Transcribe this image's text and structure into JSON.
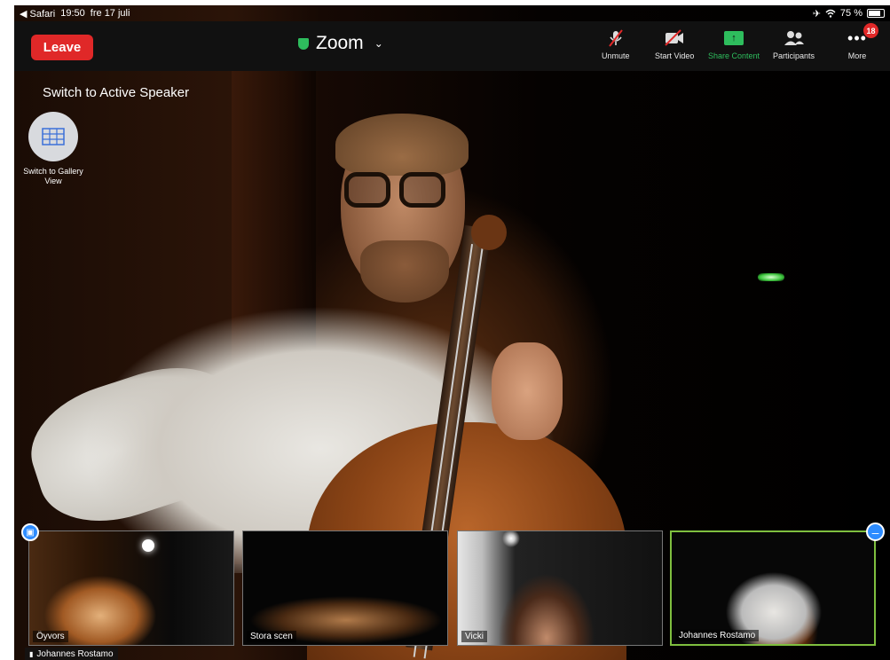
{
  "statusbar": {
    "back_app": "◀ Safari",
    "time": "19:50",
    "date": "fre 17 juli",
    "battery": "75 %"
  },
  "toolbar": {
    "leave_label": "Leave",
    "title": "Zoom",
    "buttons": [
      {
        "label": "Unmute",
        "icon": "mic-muted-icon"
      },
      {
        "label": "Start Video",
        "icon": "video-off-icon"
      },
      {
        "label": "Share Content",
        "icon": "share-icon"
      },
      {
        "label": "Participants",
        "icon": "participants-icon"
      },
      {
        "label": "More",
        "icon": "more-icon",
        "badge": "18"
      }
    ]
  },
  "overlay": {
    "switch_speaker": "Switch to Active Speaker",
    "gallery_label": "Switch to Gallery View"
  },
  "thumbnails": [
    {
      "name": "Öyvors"
    },
    {
      "name": "Stora scen"
    },
    {
      "name": "Vicki"
    },
    {
      "name": "Johannes Rostamo",
      "active": true
    }
  ],
  "active_speaker_name": "Johannes Rostamo",
  "colors": {
    "leave": "#e02828",
    "share": "#2ebd5d",
    "active_border": "#7fbf3f",
    "badge": "#e02828",
    "pin": "#2d8cff"
  }
}
